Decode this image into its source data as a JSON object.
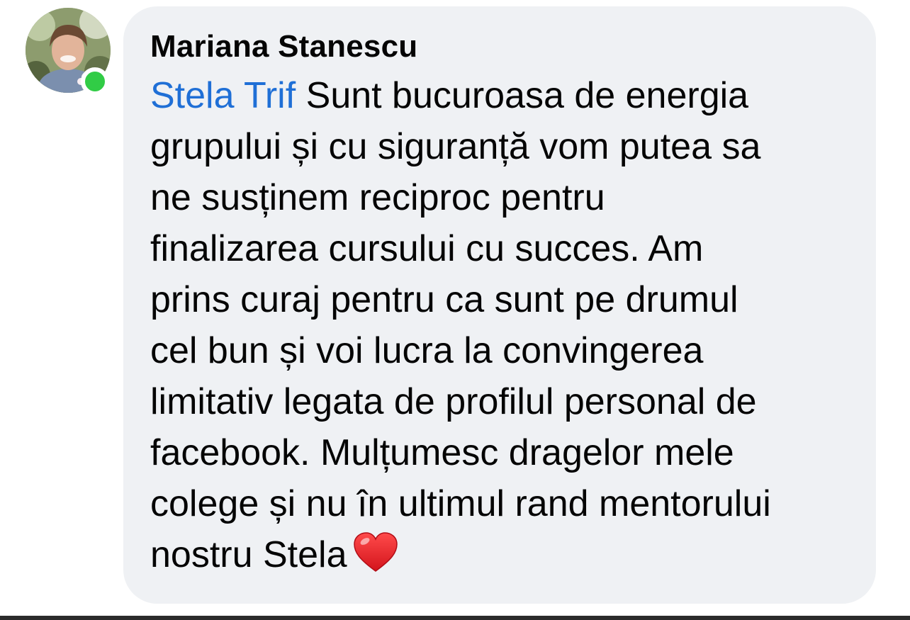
{
  "comment": {
    "author": "Mariana Stanescu",
    "online": true,
    "mention": "Stela Trif",
    "lines": [
      " Sunt bucuroasa de energia",
      "grupului și cu siguranță vom putea sa",
      "ne susținem reciproc pentru",
      "finalizarea cursului cu succes. Am",
      "prins curaj pentru ca sunt pe drumul",
      "cel bun și voi lucra la convingerea",
      "limitativ legata de profilul personal de",
      "facebook. Mulțumesc dragelor mele",
      "colege și nu în ultimul rand mentorului",
      "nostru Stela"
    ],
    "emoji": "red-heart"
  },
  "colors": {
    "bubble": "#eff1f4",
    "mention": "#1f6fd6",
    "text": "#050505",
    "presence": "#31cc46"
  }
}
